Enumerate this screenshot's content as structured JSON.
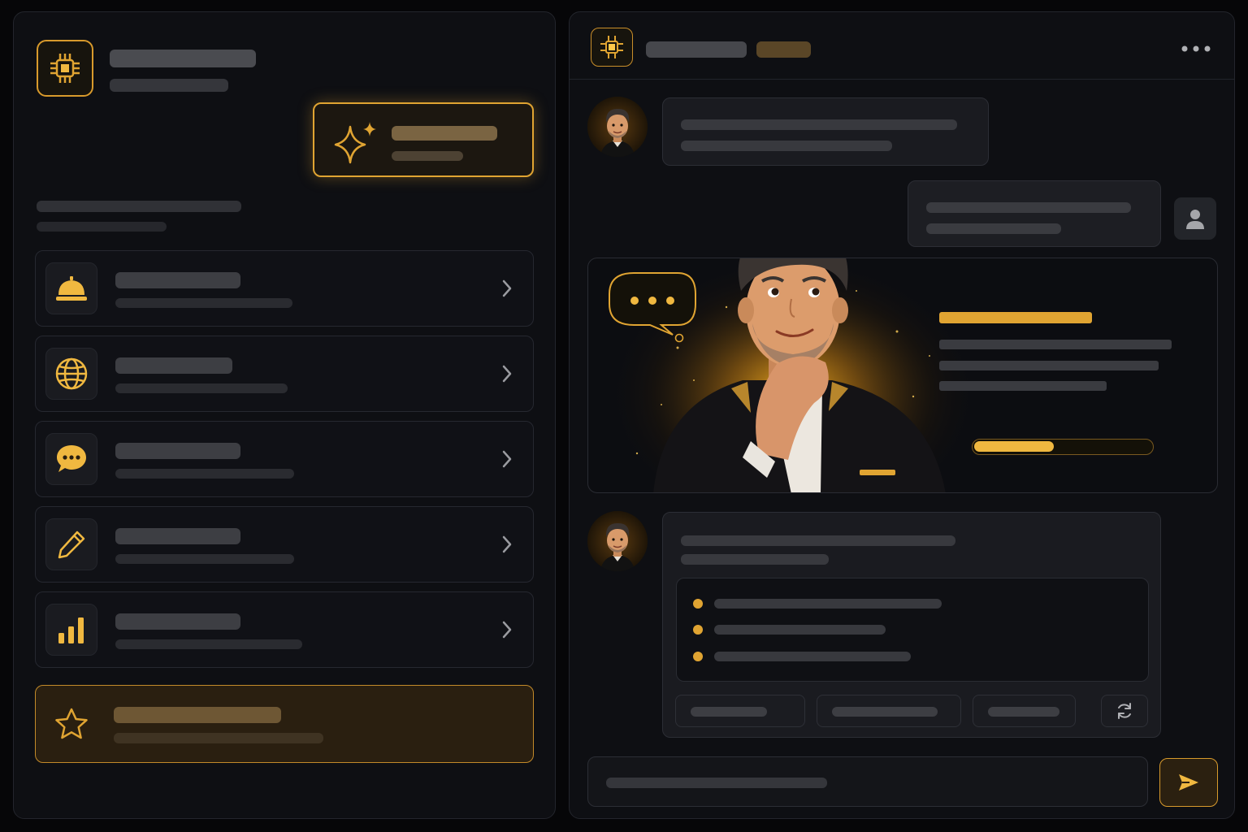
{
  "left_panel": {
    "logo_icon": "chip-icon",
    "featured_card_icon": "sparkle-icon",
    "menu_items": [
      {
        "icon": "service-bell-icon"
      },
      {
        "icon": "globe-icon"
      },
      {
        "icon": "chat-bubble-icon"
      },
      {
        "icon": "pencil-icon"
      },
      {
        "icon": "bar-chart-icon"
      }
    ],
    "featured_item_icon": "star-icon"
  },
  "chat_panel": {
    "header_icon": "chip-icon",
    "menu_icon": "more-horizontal-icon",
    "thinking_icon": "thinking-bubble-icon",
    "progress_fraction": 0.45,
    "bullet_count": 3,
    "refresh_icon": "refresh-icon",
    "send_icon": "send-icon",
    "user_icon": "user-icon"
  },
  "colors": {
    "accent": "#e0a432",
    "background": "#0e0f13",
    "surface": "#1a1b20",
    "placeholder_bar": "#3a3b40"
  }
}
